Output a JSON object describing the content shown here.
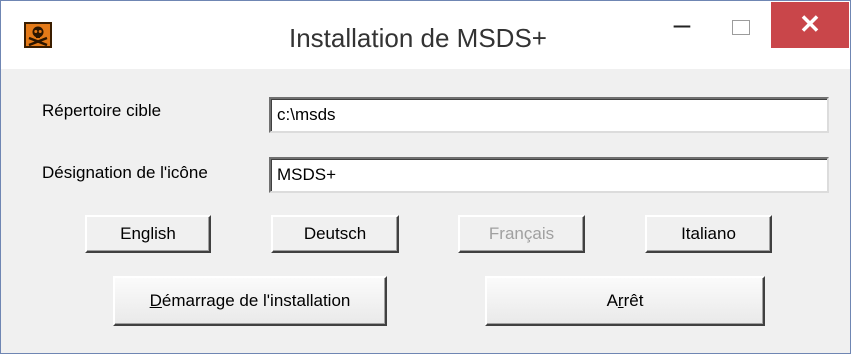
{
  "window": {
    "title": "Installation de MSDS+",
    "minimize_glyph": "–",
    "close_glyph": "✕",
    "icon": "skull-crossbones-icon"
  },
  "fields": {
    "target_dir": {
      "label": "Répertoire cible",
      "value": "c:\\msds"
    },
    "icon_name": {
      "label": "Désignation de l'icône",
      "value": "MSDS+"
    }
  },
  "languages": {
    "english": "English",
    "deutsch": "Deutsch",
    "francais": "Français",
    "italiano": "Italiano"
  },
  "actions": {
    "start": {
      "mnemonic": "D",
      "rest": "émarrage de l'installation"
    },
    "stop": {
      "pre": "A",
      "mnemonic": "r",
      "rest": "rêt"
    }
  },
  "colors": {
    "close_button": "#c9464a",
    "icon_background": "#e47a18",
    "disabled_text": "#a0a0a0"
  }
}
